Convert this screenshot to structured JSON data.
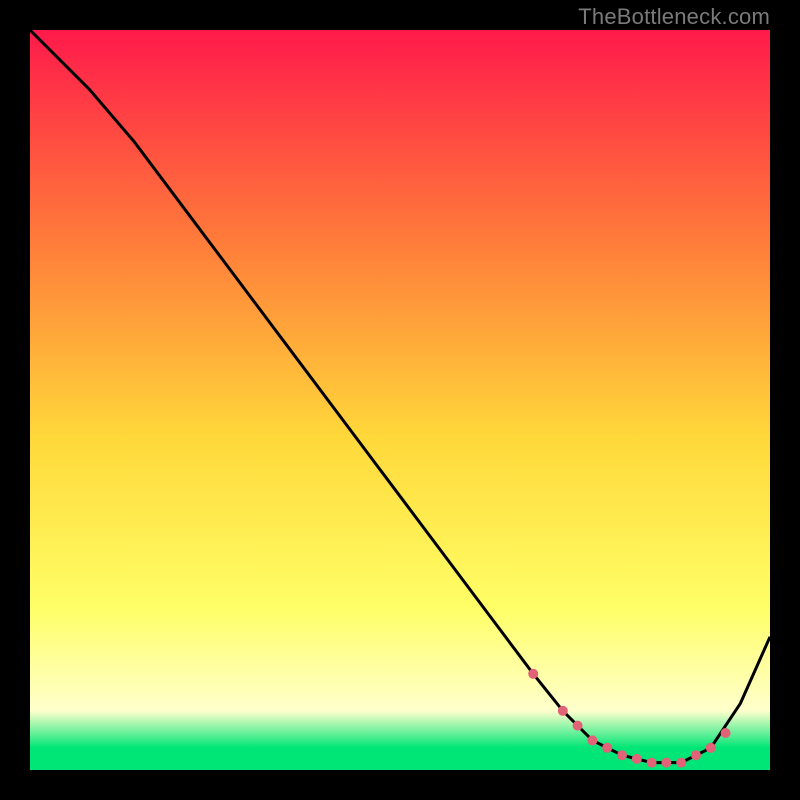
{
  "watermark": "TheBottleneck.com",
  "colors": {
    "grad_top": "#ff1a4b",
    "grad_mid1": "#ff7a3a",
    "grad_mid2": "#ffd83a",
    "grad_mid3": "#ffff66",
    "grad_bottom_yellow": "#ffffcc",
    "grad_green": "#00e676",
    "line": "#000000",
    "dot": "#e06377"
  },
  "chart_data": {
    "type": "line",
    "title": "",
    "xlabel": "",
    "ylabel": "",
    "xlim": [
      0,
      100
    ],
    "ylim": [
      0,
      100
    ],
    "grid": false,
    "legend": false,
    "series": [
      {
        "name": "curve",
        "x": [
          0,
          8,
          14,
          20,
          26,
          32,
          38,
          44,
          50,
          56,
          62,
          68,
          72,
          76,
          80,
          84,
          88,
          92,
          96,
          100
        ],
        "y": [
          100,
          92,
          85,
          77,
          69,
          61,
          53,
          45,
          37,
          29,
          21,
          13,
          8,
          4,
          2,
          1,
          1,
          3,
          9,
          18
        ]
      }
    ],
    "dots": {
      "name": "highlight",
      "x": [
        68,
        72,
        74,
        76,
        78,
        80,
        82,
        84,
        86,
        88,
        90,
        92,
        94
      ],
      "y": [
        13,
        8,
        6,
        4,
        3,
        2,
        1.5,
        1,
        1,
        1,
        2,
        3,
        5
      ]
    }
  }
}
